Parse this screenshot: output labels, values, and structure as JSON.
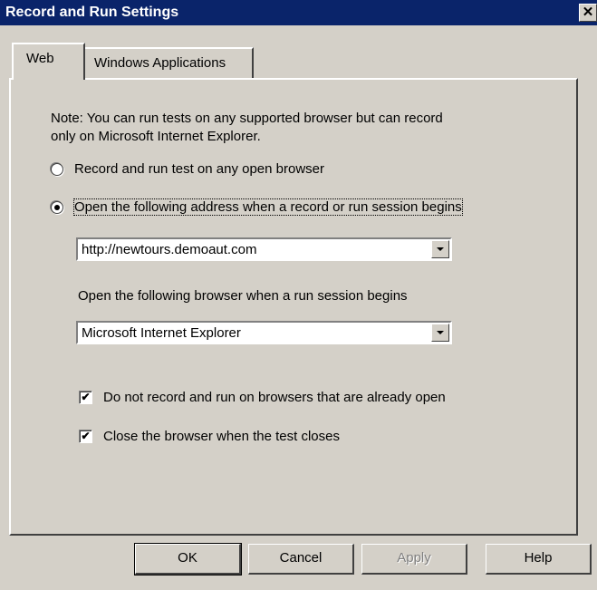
{
  "window": {
    "title": "Record and Run Settings",
    "close_glyph": "✕"
  },
  "tabs": [
    {
      "label": "Web",
      "selected": true
    },
    {
      "label": "Windows Applications",
      "selected": false
    }
  ],
  "note_line1": "Note: You can run tests on any supported browser but can record",
  "note_line2": "only on Microsoft Internet Explorer.",
  "radio_any": {
    "label": "Record and run test on any open browser",
    "checked": false
  },
  "radio_open": {
    "label": "Open the following address when a record or run session begins",
    "checked": true
  },
  "address_combo": {
    "value": "http://newtours.demoaut.com"
  },
  "browser_label": "Open the following browser when a run session begins",
  "browser_combo": {
    "value": "Microsoft Internet Explorer"
  },
  "check_no_open": {
    "label": "Do not record and run on browsers that are already open",
    "checked": true,
    "mark": "✔"
  },
  "check_close": {
    "label": "Close the browser when the test closes",
    "checked": true,
    "mark": "✔"
  },
  "buttons": {
    "ok": "OK",
    "cancel": "Cancel",
    "apply": "Apply",
    "help": "Help"
  }
}
